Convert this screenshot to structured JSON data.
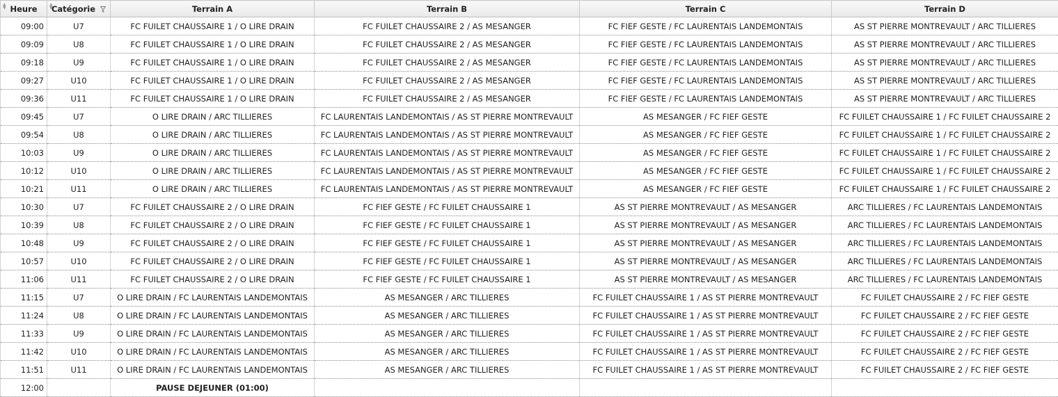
{
  "columns": {
    "heure": "Heure",
    "categorie": "Catégorie",
    "terrain_a": "Terrain A",
    "terrain_b": "Terrain B",
    "terrain_c": "Terrain C",
    "terrain_d": "Terrain D"
  },
  "icons": {
    "sort": "sort-arrows-icon",
    "filter": "filter-funnel-icon"
  },
  "rows": [
    {
      "heure": "09:00",
      "cat": "U7",
      "a": "FC FUILET CHAUSSAIRE 1 / O LIRE DRAIN",
      "b": "FC FUILET CHAUSSAIRE 2 / AS MESANGER",
      "c": "FC FIEF GESTE / FC LAURENTAIS LANDEMONTAIS",
      "d": "AS ST PIERRE MONTREVAULT / ARC TILLIERES"
    },
    {
      "heure": "09:09",
      "cat": "U8",
      "a": "FC FUILET CHAUSSAIRE 1 / O LIRE DRAIN",
      "b": "FC FUILET CHAUSSAIRE 2 / AS MESANGER",
      "c": "FC FIEF GESTE / FC LAURENTAIS LANDEMONTAIS",
      "d": "AS ST PIERRE MONTREVAULT / ARC TILLIERES"
    },
    {
      "heure": "09:18",
      "cat": "U9",
      "a": "FC FUILET CHAUSSAIRE 1 / O LIRE DRAIN",
      "b": "FC FUILET CHAUSSAIRE 2 / AS MESANGER",
      "c": "FC FIEF GESTE / FC LAURENTAIS LANDEMONTAIS",
      "d": "AS ST PIERRE MONTREVAULT / ARC TILLIERES"
    },
    {
      "heure": "09:27",
      "cat": "U10",
      "a": "FC FUILET CHAUSSAIRE 1 / O LIRE DRAIN",
      "b": "FC FUILET CHAUSSAIRE 2 / AS MESANGER",
      "c": "FC FIEF GESTE / FC LAURENTAIS LANDEMONTAIS",
      "d": "AS ST PIERRE MONTREVAULT / ARC TILLIERES"
    },
    {
      "heure": "09:36",
      "cat": "U11",
      "a": "FC FUILET CHAUSSAIRE 1 / O LIRE DRAIN",
      "b": "FC FUILET CHAUSSAIRE 2 / AS MESANGER",
      "c": "FC FIEF GESTE / FC LAURENTAIS LANDEMONTAIS",
      "d": "AS ST PIERRE MONTREVAULT / ARC TILLIERES"
    },
    {
      "heure": "09:45",
      "cat": "U7",
      "a": "O LIRE DRAIN / ARC TILLIERES",
      "b": "FC LAURENTAIS LANDEMONTAIS / AS ST PIERRE MONTREVAULT",
      "c": "AS MESANGER / FC FIEF GESTE",
      "d": "FC FUILET CHAUSSAIRE 1 / FC FUILET CHAUSSAIRE 2"
    },
    {
      "heure": "09:54",
      "cat": "U8",
      "a": "O LIRE DRAIN / ARC TILLIERES",
      "b": "FC LAURENTAIS LANDEMONTAIS / AS ST PIERRE MONTREVAULT",
      "c": "AS MESANGER / FC FIEF GESTE",
      "d": "FC FUILET CHAUSSAIRE 1 / FC FUILET CHAUSSAIRE 2"
    },
    {
      "heure": "10:03",
      "cat": "U9",
      "a": "O LIRE DRAIN / ARC TILLIERES",
      "b": "FC LAURENTAIS LANDEMONTAIS / AS ST PIERRE MONTREVAULT",
      "c": "AS MESANGER / FC FIEF GESTE",
      "d": "FC FUILET CHAUSSAIRE 1 / FC FUILET CHAUSSAIRE 2"
    },
    {
      "heure": "10:12",
      "cat": "U10",
      "a": "O LIRE DRAIN / ARC TILLIERES",
      "b": "FC LAURENTAIS LANDEMONTAIS / AS ST PIERRE MONTREVAULT",
      "c": "AS MESANGER / FC FIEF GESTE",
      "d": "FC FUILET CHAUSSAIRE 1 / FC FUILET CHAUSSAIRE 2"
    },
    {
      "heure": "10:21",
      "cat": "U11",
      "a": "O LIRE DRAIN / ARC TILLIERES",
      "b": "FC LAURENTAIS LANDEMONTAIS / AS ST PIERRE MONTREVAULT",
      "c": "AS MESANGER / FC FIEF GESTE",
      "d": "FC FUILET CHAUSSAIRE 1 / FC FUILET CHAUSSAIRE 2"
    },
    {
      "heure": "10:30",
      "cat": "U7",
      "a": "FC FUILET CHAUSSAIRE 2 / O LIRE DRAIN",
      "b": "FC FIEF GESTE / FC FUILET CHAUSSAIRE 1",
      "c": "AS ST PIERRE MONTREVAULT / AS MESANGER",
      "d": "ARC TILLIERES / FC LAURENTAIS LANDEMONTAIS"
    },
    {
      "heure": "10:39",
      "cat": "U8",
      "a": "FC FUILET CHAUSSAIRE 2 / O LIRE DRAIN",
      "b": "FC FIEF GESTE / FC FUILET CHAUSSAIRE 1",
      "c": "AS ST PIERRE MONTREVAULT / AS MESANGER",
      "d": "ARC TILLIERES / FC LAURENTAIS LANDEMONTAIS"
    },
    {
      "heure": "10:48",
      "cat": "U9",
      "a": "FC FUILET CHAUSSAIRE 2 / O LIRE DRAIN",
      "b": "FC FIEF GESTE / FC FUILET CHAUSSAIRE 1",
      "c": "AS ST PIERRE MONTREVAULT / AS MESANGER",
      "d": "ARC TILLIERES / FC LAURENTAIS LANDEMONTAIS"
    },
    {
      "heure": "10:57",
      "cat": "U10",
      "a": "FC FUILET CHAUSSAIRE 2 / O LIRE DRAIN",
      "b": "FC FIEF GESTE / FC FUILET CHAUSSAIRE 1",
      "c": "AS ST PIERRE MONTREVAULT / AS MESANGER",
      "d": "ARC TILLIERES / FC LAURENTAIS LANDEMONTAIS"
    },
    {
      "heure": "11:06",
      "cat": "U11",
      "a": "FC FUILET CHAUSSAIRE 2 / O LIRE DRAIN",
      "b": "FC FIEF GESTE / FC FUILET CHAUSSAIRE 1",
      "c": "AS ST PIERRE MONTREVAULT / AS MESANGER",
      "d": "ARC TILLIERES / FC LAURENTAIS LANDEMONTAIS"
    },
    {
      "heure": "11:15",
      "cat": "U7",
      "a": "O LIRE DRAIN / FC LAURENTAIS LANDEMONTAIS",
      "b": "AS MESANGER / ARC TILLIERES",
      "c": "FC FUILET CHAUSSAIRE 1 / AS ST PIERRE MONTREVAULT",
      "d": "FC FUILET CHAUSSAIRE 2 / FC FIEF GESTE"
    },
    {
      "heure": "11:24",
      "cat": "U8",
      "a": "O LIRE DRAIN / FC LAURENTAIS LANDEMONTAIS",
      "b": "AS MESANGER / ARC TILLIERES",
      "c": "FC FUILET CHAUSSAIRE 1 / AS ST PIERRE MONTREVAULT",
      "d": "FC FUILET CHAUSSAIRE 2 / FC FIEF GESTE"
    },
    {
      "heure": "11:33",
      "cat": "U9",
      "a": "O LIRE DRAIN / FC LAURENTAIS LANDEMONTAIS",
      "b": "AS MESANGER / ARC TILLIERES",
      "c": "FC FUILET CHAUSSAIRE 1 / AS ST PIERRE MONTREVAULT",
      "d": "FC FUILET CHAUSSAIRE 2 / FC FIEF GESTE"
    },
    {
      "heure": "11:42",
      "cat": "U10",
      "a": "O LIRE DRAIN / FC LAURENTAIS LANDEMONTAIS",
      "b": "AS MESANGER / ARC TILLIERES",
      "c": "FC FUILET CHAUSSAIRE 1 / AS ST PIERRE MONTREVAULT",
      "d": "FC FUILET CHAUSSAIRE 2 / FC FIEF GESTE"
    },
    {
      "heure": "11:51",
      "cat": "U11",
      "a": "O LIRE DRAIN / FC LAURENTAIS LANDEMONTAIS",
      "b": "AS MESANGER / ARC TILLIERES",
      "c": "FC FUILET CHAUSSAIRE 1 / AS ST PIERRE MONTREVAULT",
      "d": "FC FUILET CHAUSSAIRE 2 / FC FIEF GESTE"
    }
  ],
  "pause": {
    "heure": "12:00",
    "label": "PAUSE DEJEUNER (01:00)"
  }
}
